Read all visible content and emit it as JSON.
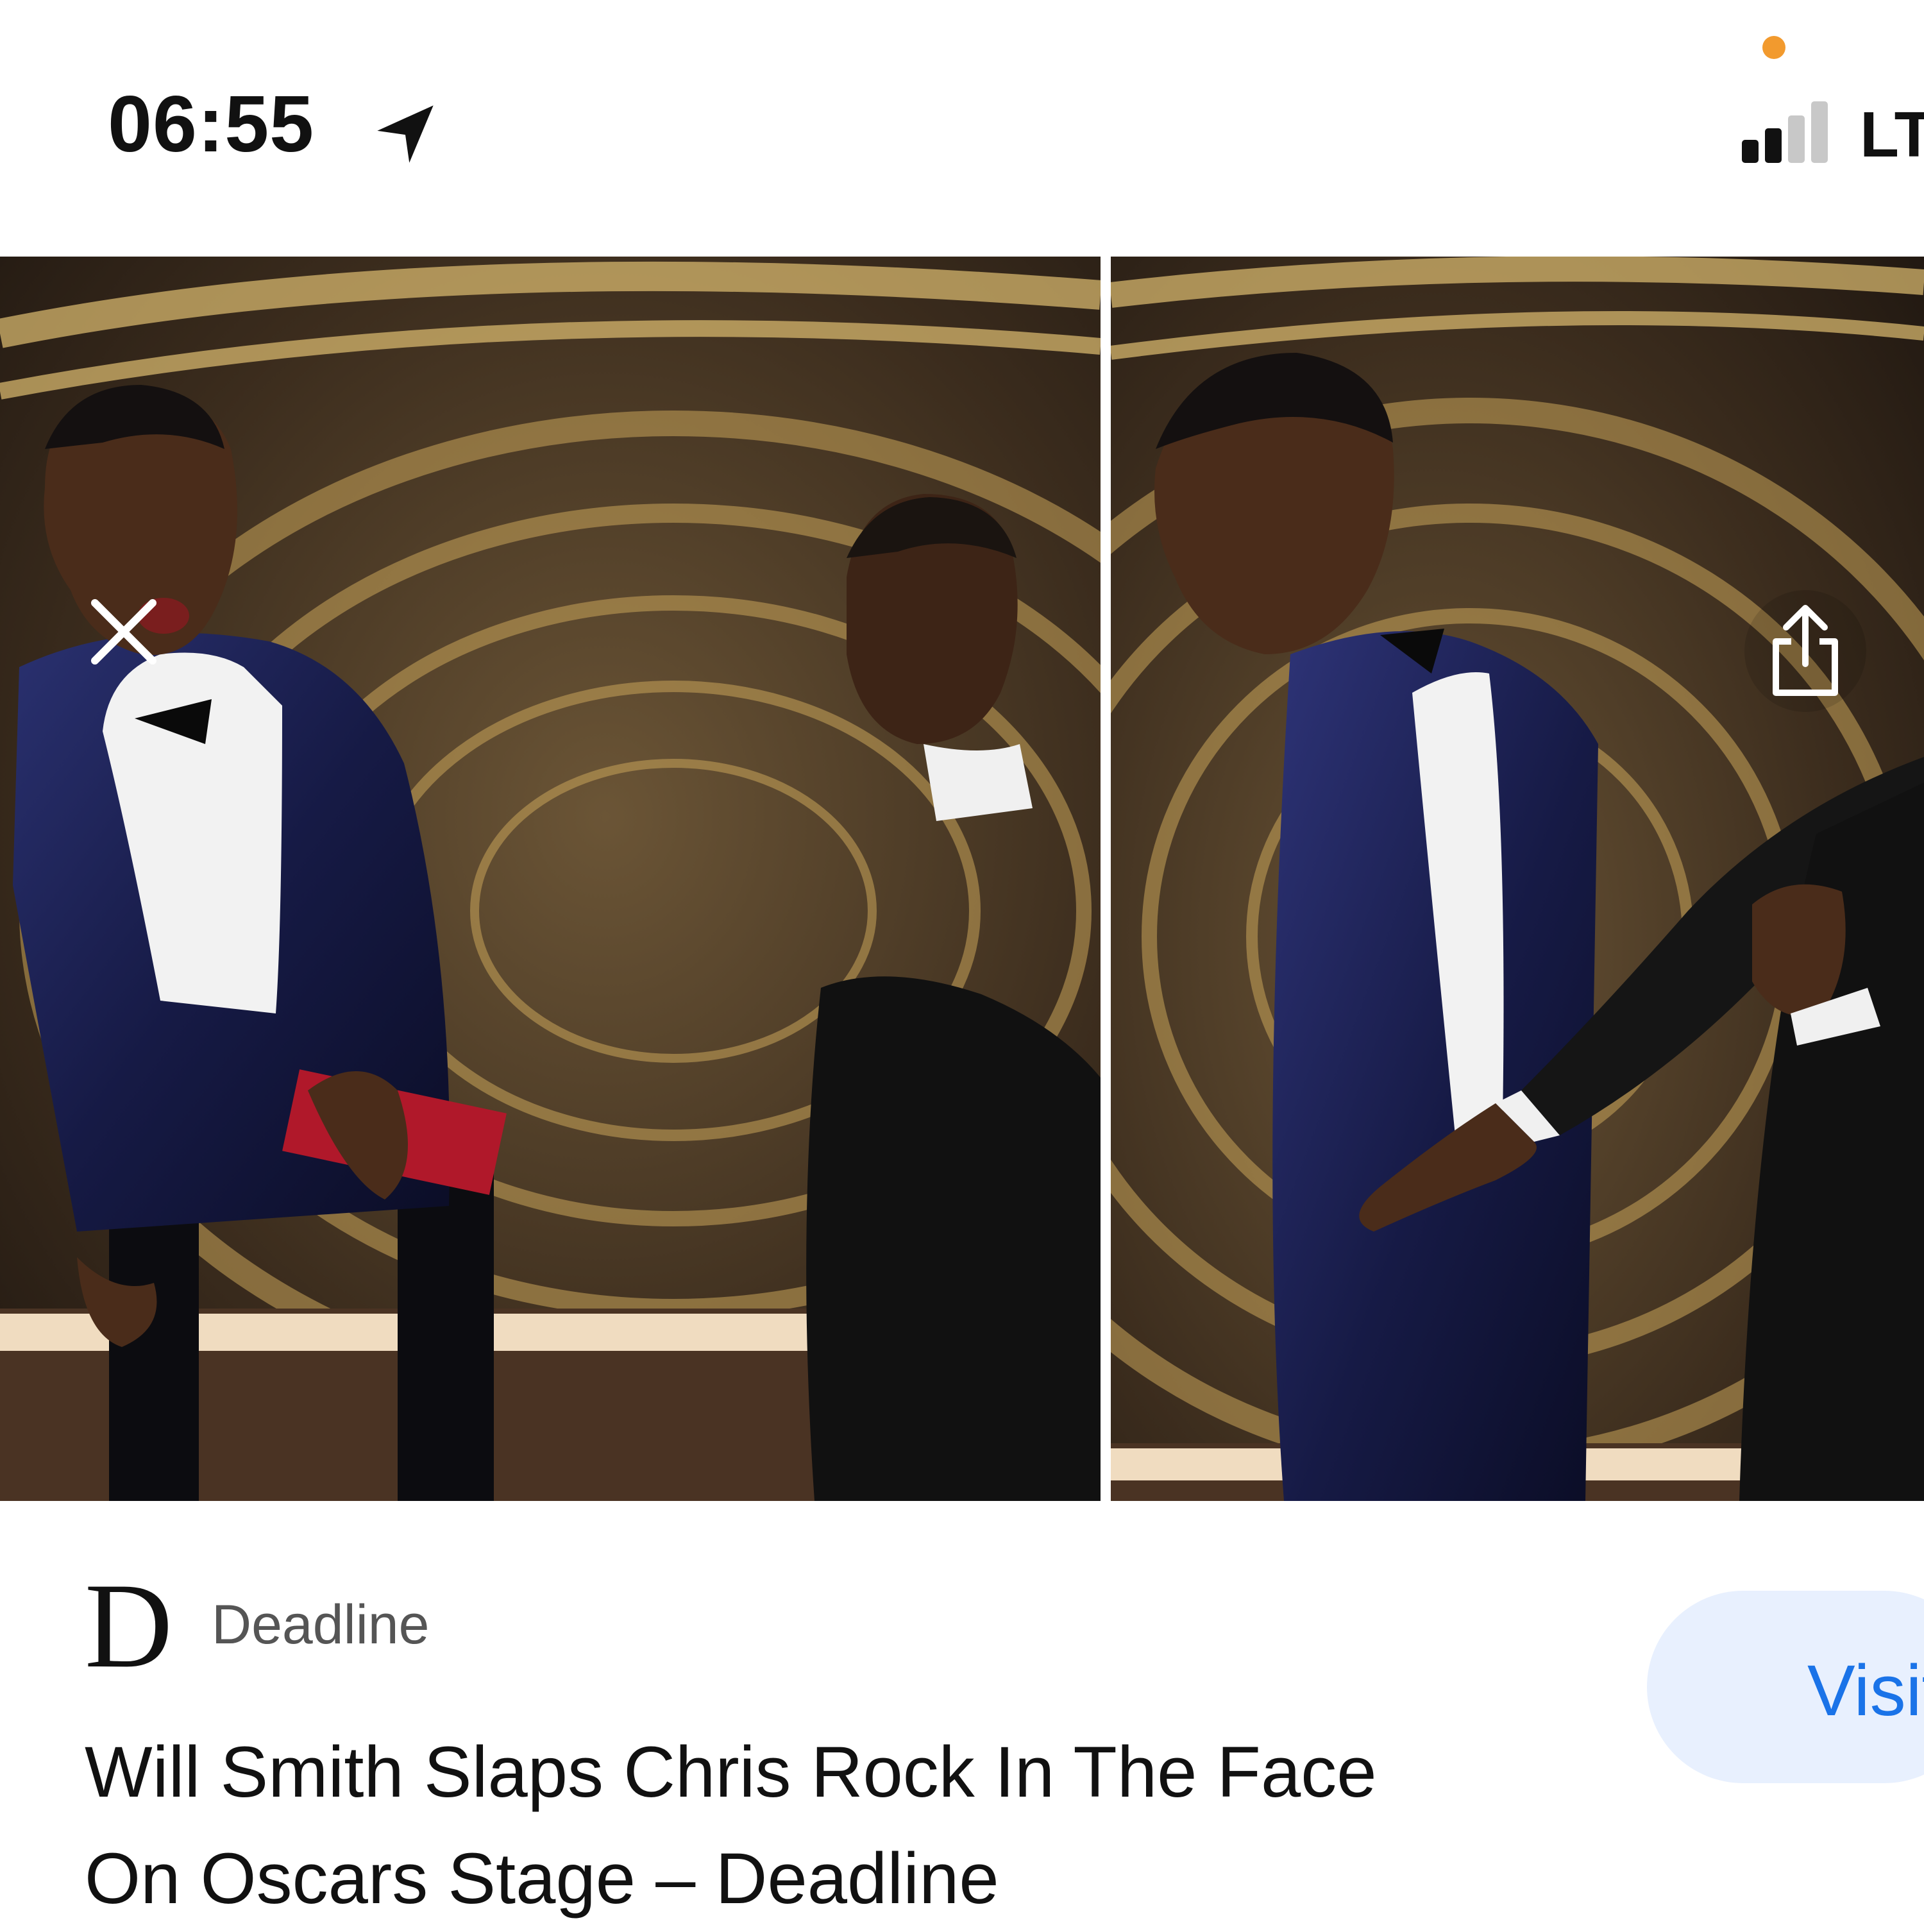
{
  "status_bar": {
    "time": "06:55",
    "carrier": "LT",
    "privacy_dot_color": "#F29A2E",
    "icons": [
      "location-arrow-icon",
      "signal-bars-icon"
    ],
    "signal_bars_active": 2,
    "signal_bars_total": 4
  },
  "viewer": {
    "close_icon": "close-icon",
    "share_icon": "share-icon",
    "images": [
      {
        "name": "photo-left",
        "subject": "two men in tuxedos on stage"
      },
      {
        "name": "photo-right",
        "subject": "man slapping another man on stage"
      }
    ]
  },
  "result": {
    "source_logo": "D",
    "source_name": "Deadline",
    "title_lines": [
      "Will Smith Slaps Chris Rock In The Face",
      "On Oscars Stage – Deadline"
    ],
    "visit_label": "Visit",
    "accent_color": "#1A73E8"
  }
}
